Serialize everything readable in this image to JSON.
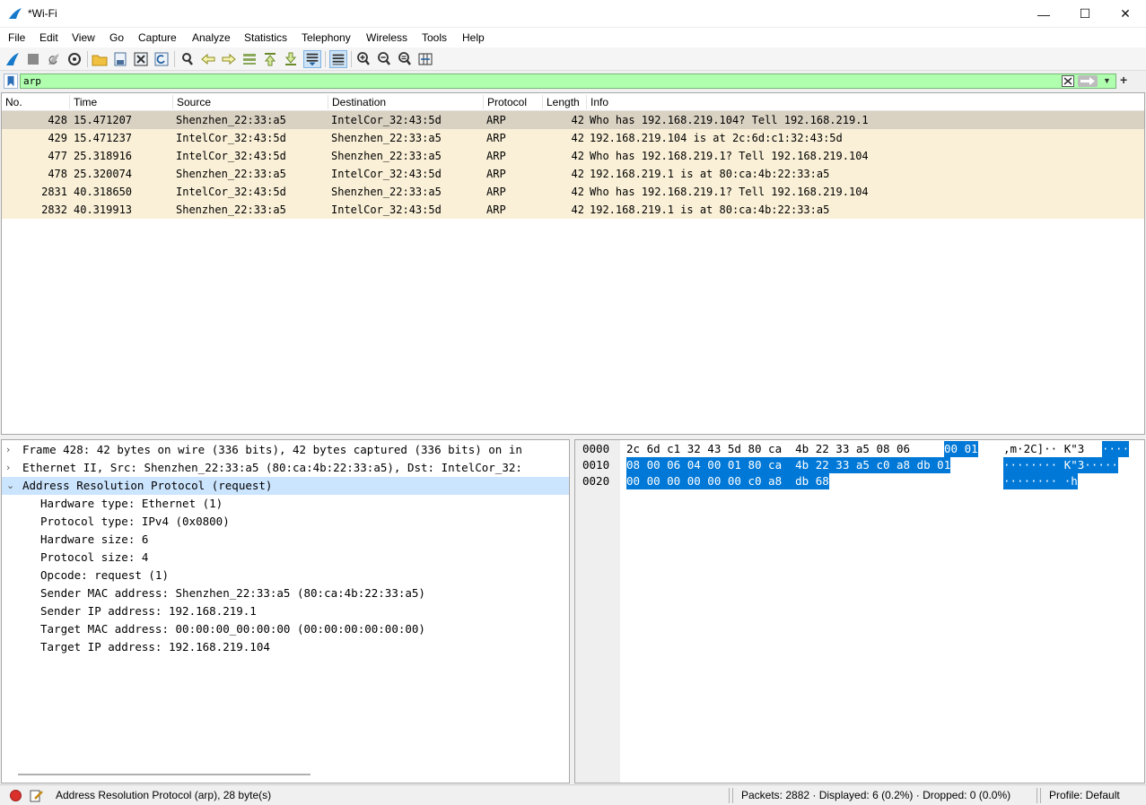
{
  "window": {
    "title": "*Wi-Fi",
    "minimize": "—",
    "maximize": "☐",
    "close": "✕"
  },
  "menu": [
    "File",
    "Edit",
    "View",
    "Go",
    "Capture",
    "Analyze",
    "Statistics",
    "Telephony",
    "Wireless",
    "Tools",
    "Help"
  ],
  "toolbar": {
    "buttons": [
      "start-capture-icon",
      "stop-capture-icon",
      "restart-capture-icon",
      "capture-options-icon",
      "open-file-icon",
      "save-file-icon",
      "close-file-icon",
      "reload-file-icon",
      "find-packet-icon",
      "go-back-icon",
      "go-forward-icon",
      "go-to-packet-icon",
      "go-first-icon",
      "go-last-icon",
      "autoscroll-icon",
      "colorize-icon",
      "zoom-in-icon",
      "zoom-out-icon",
      "normal-size-icon",
      "resize-columns-icon"
    ]
  },
  "filter": {
    "value": "arp",
    "clear": "✕",
    "apply": "⟹",
    "dropdown": "▼",
    "add": "+"
  },
  "packet_list": {
    "columns": [
      "No.",
      "Time",
      "Source",
      "Destination",
      "Protocol",
      "Length",
      "Info"
    ],
    "rows": [
      {
        "no": "428",
        "time": "15.471207",
        "source": "Shenzhen_22:33:a5",
        "destination": "IntelCor_32:43:5d",
        "protocol": "ARP",
        "length": "42",
        "info": "Who has 192.168.219.104? Tell 192.168.219.1",
        "selected": true
      },
      {
        "no": "429",
        "time": "15.471237",
        "source": "IntelCor_32:43:5d",
        "destination": "Shenzhen_22:33:a5",
        "protocol": "ARP",
        "length": "42",
        "info": "192.168.219.104 is at 2c:6d:c1:32:43:5d",
        "selected": false
      },
      {
        "no": "477",
        "time": "25.318916",
        "source": "IntelCor_32:43:5d",
        "destination": "Shenzhen_22:33:a5",
        "protocol": "ARP",
        "length": "42",
        "info": "Who has 192.168.219.1? Tell 192.168.219.104",
        "selected": false
      },
      {
        "no": "478",
        "time": "25.320074",
        "source": "Shenzhen_22:33:a5",
        "destination": "IntelCor_32:43:5d",
        "protocol": "ARP",
        "length": "42",
        "info": "192.168.219.1 is at 80:ca:4b:22:33:a5",
        "selected": false
      },
      {
        "no": "2831",
        "time": "40.318650",
        "source": "IntelCor_32:43:5d",
        "destination": "Shenzhen_22:33:a5",
        "protocol": "ARP",
        "length": "42",
        "info": "Who has 192.168.219.1? Tell 192.168.219.104",
        "selected": false
      },
      {
        "no": "2832",
        "time": "40.319913",
        "source": "Shenzhen_22:33:a5",
        "destination": "IntelCor_32:43:5d",
        "protocol": "ARP",
        "length": "42",
        "info": "192.168.219.1 is at 80:ca:4b:22:33:a5",
        "selected": false
      }
    ]
  },
  "details": {
    "arrow_collapsed": "›",
    "arrow_expanded": "⌄",
    "frame": "Frame 428: 42 bytes on wire (336 bits), 42 bytes captured (336 bits) on in",
    "ethernet": "Ethernet II, Src: Shenzhen_22:33:a5 (80:ca:4b:22:33:a5), Dst: IntelCor_32:",
    "arp": "Address Resolution Protocol (request)",
    "fields": [
      "Hardware type: Ethernet (1)",
      "Protocol type: IPv4 (0x0800)",
      "Hardware size: 6",
      "Protocol size: 4",
      "Opcode: request (1)",
      "Sender MAC address: Shenzhen_22:33:a5 (80:ca:4b:22:33:a5)",
      "Sender IP address: 192.168.219.1",
      "Target MAC address: 00:00:00_00:00:00 (00:00:00:00:00:00)",
      "Target IP address: 192.168.219.104"
    ]
  },
  "hex": {
    "offsets": [
      "0000",
      "0010",
      "0020"
    ],
    "line0_plain": "2c 6d c1 32 43 5d 80 ca  4b 22 33 a5 08 06",
    "line0_sel": "00 01",
    "line0_ascii_plain": ",m·2C]·· K\"3",
    "line0_ascii_sel": "····",
    "line1_sel": "08 00 06 04 00 01 80 ca  4b 22 33 a5 c0 a8 db 01",
    "line1_ascii_sel": "········ K\"3·····",
    "line2_sel": "00 00 00 00 00 00 c0 a8  db 68",
    "line2_ascii_sel": "········ ·h"
  },
  "status": {
    "selection": "Address Resolution Protocol (arp), 28 byte(s)",
    "packets": "Packets: 2882 · Displayed: 6 (0.2%) · Dropped: 0 (0.0%)",
    "profile": "Profile: Default"
  }
}
